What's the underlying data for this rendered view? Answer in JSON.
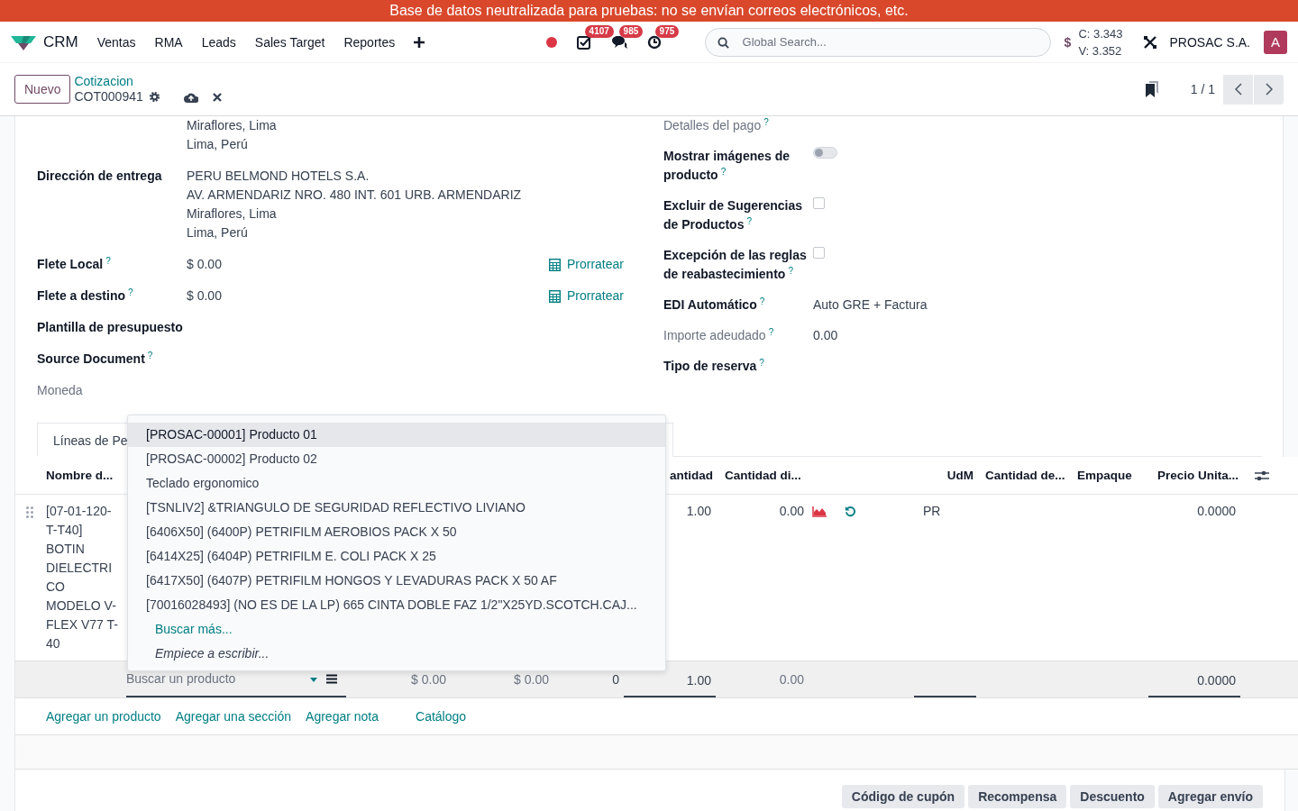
{
  "banner": "Base de datos neutralizada para pruebas: no se envían correos electrónicos, etc.",
  "navbar": {
    "app": "CRM",
    "menus": [
      "Ventas",
      "RMA",
      "Leads",
      "Sales Target",
      "Reportes"
    ],
    "badges": [
      {
        "kind": "activity",
        "count": "4107"
      },
      {
        "kind": "chat",
        "count": "985"
      },
      {
        "kind": "clock",
        "count": "975"
      }
    ],
    "search": {
      "placeholder": "Global Search..."
    },
    "currency_symbol": "$",
    "rates": [
      "C: 3.343",
      "V: 3.352"
    ],
    "company": "PROSAC S.A.",
    "avatar": "A"
  },
  "control_panel": {
    "new_button": "Nuevo",
    "breadcrumb": "Cotizacion",
    "record": "COT000941",
    "pager": "1 / 1"
  },
  "form": {
    "address_continuation": [
      "Miraflores, Lima",
      "Lima, Perú"
    ],
    "left_fields": [
      {
        "label": "Dirección de entrega",
        "muted": false,
        "lines": [
          "PERU BELMOND HOTELS S.A.",
          "AV. ARMENDARIZ NRO. 480 INT. 601 URB. ARMENDARIZ",
          "Miraflores, Lima",
          "Lima, Perú"
        ]
      },
      {
        "label": "Flete Local",
        "help": "?",
        "muted": false,
        "lines": [
          "$ 0.00"
        ],
        "action": "Prorratear"
      },
      {
        "label": "Flete a destino",
        "help": "?",
        "muted": false,
        "lines": [
          "$ 0.00"
        ],
        "action": "Prorratear"
      },
      {
        "label": "Plantilla de presupuesto",
        "muted": false
      },
      {
        "label": "Source Document",
        "help": "?",
        "muted": false
      },
      {
        "label": "Moneda",
        "muted": true
      }
    ],
    "right_fields": [
      {
        "kind": "none",
        "label": "Detalles del pago",
        "help": "?",
        "muted": true
      },
      {
        "kind": "toggle",
        "label": "Mostrar imágenes de producto",
        "help": "?",
        "muted": false,
        "on": false
      },
      {
        "kind": "checkbox",
        "label": "Excluir de Sugerencias de Productos",
        "help": "?",
        "muted": false,
        "checked": false
      },
      {
        "kind": "checkbox",
        "label": "Excepción de las reglas de reabastecimiento",
        "help": "?",
        "muted": false,
        "checked": false
      },
      {
        "kind": "text",
        "label": "EDI Automático",
        "help": "?",
        "muted": false,
        "value": "Auto GRE + Factura"
      },
      {
        "kind": "text",
        "label": "Importe adeudado",
        "help": "?",
        "muted": true,
        "value": "0.00"
      },
      {
        "kind": "none",
        "label": "Tipo de reserva",
        "help": "?",
        "muted": false
      }
    ]
  },
  "tabs": [
    {
      "label": "Líneas de Pe",
      "selected": true
    }
  ],
  "table": {
    "columns": [
      "Nombre d...",
      "antidad",
      "Cantidad di...",
      "UdM",
      "Cantidad de...",
      "Empaque",
      "Precio Unita..."
    ],
    "rows": [
      {
        "name": "[07-01-120-T-T40] BOTIN DIELECTRICO MODELO V-FLEX V77 T-40",
        "quantity": "1.00",
        "delivered": "0.00",
        "uom": "PR",
        "price": "0.0000"
      }
    ],
    "edit_row": {
      "placeholder": "Buscar un producto",
      "price_1": "$ 0.00",
      "price_2": "$ 0.00",
      "count": "0",
      "quantity": "1.00",
      "delivered": "0.00",
      "price": "0.0000"
    }
  },
  "dropdown": {
    "items": [
      {
        "label": "[PROSAC-00001] Producto 01",
        "selected": true
      },
      {
        "label": "[PROSAC-00002] Producto 02",
        "selected": false
      },
      {
        "label": "Teclado ergonomico",
        "selected": false
      },
      {
        "label": "[TSNLIV2] &TRIANGULO DE SEGURIDAD REFLECTIVO LIVIANO",
        "selected": false
      },
      {
        "label": "[6406X50] (6400P) PETRIFILM AEROBIOS PACK X 50",
        "selected": false
      },
      {
        "label": "[6414X25] (6404P) PETRIFILM E. COLI PACK X 25",
        "selected": false
      },
      {
        "label": "[6417X50] (6407P) PETRIFILM HONGOS Y LEVADURAS PACK X 50 AF",
        "selected": false
      },
      {
        "label": "[70016028493] (NO ES DE LA LP) 665 CINTA DOBLE FAZ 1/2\"X25YD.SCOTCH.CAJ...",
        "selected": false
      }
    ],
    "search_more": "Buscar más...",
    "hint": "Empiece a escribir..."
  },
  "add_links": [
    "Agregar un producto",
    "Agregar una sección",
    "Agregar nota",
    "Catálogo"
  ],
  "buttons": [
    "Código de cupón",
    "Recompensa",
    "Descuento",
    "Agregar envío"
  ]
}
